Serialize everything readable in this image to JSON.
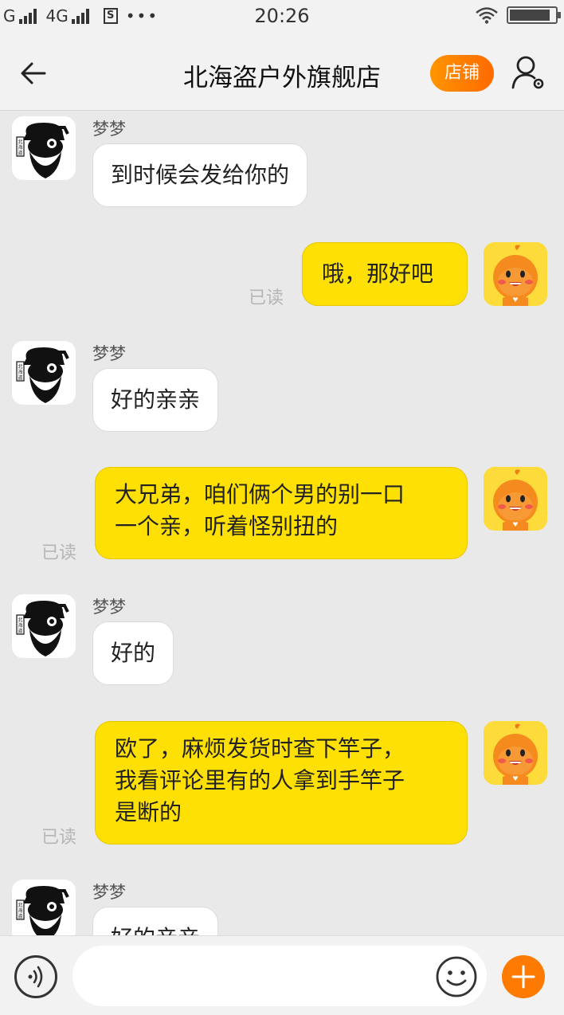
{
  "status_bar": {
    "carrier_1": "G",
    "carrier_2": "4G",
    "sim_icon": "S",
    "more": "•••",
    "time": "20:26",
    "battery_level": 0.9
  },
  "header": {
    "title": "北海盗户外旗舰店",
    "shop_button": "店铺"
  },
  "messages": [
    {
      "side": "left",
      "sender": "梦梦",
      "text": "到时候会发给你的"
    },
    {
      "side": "right",
      "text": "哦，那好吧",
      "status": "已读"
    },
    {
      "side": "left",
      "sender": "梦梦",
      "text": "好的亲亲"
    },
    {
      "side": "right",
      "text_lines": [
        "大兄弟，咱们俩个男的别一口",
        "一个亲，听着怪别扭的"
      ],
      "status": "已读"
    },
    {
      "side": "left",
      "sender": "梦梦",
      "text": "好的"
    },
    {
      "side": "right",
      "text_lines": [
        "欧了，麻烦发货时查下竿子，",
        "我看评论里有的人拿到手竿子",
        "是断的"
      ],
      "status": "已读"
    },
    {
      "side": "left",
      "sender": "梦梦",
      "text": "好的亲亲"
    }
  ],
  "seller_avatar_logo": "北海盗",
  "input": {
    "placeholder": ""
  },
  "colors": {
    "accent_orange": "#ff7a00",
    "bubble_yellow": "#ffe004",
    "background": "#e9e9e9"
  },
  "icons": {
    "back": "back-arrow-icon",
    "user_settings": "user-settings-icon",
    "voice": "voice-icon",
    "emoji": "emoji-icon",
    "plus": "plus-icon"
  }
}
